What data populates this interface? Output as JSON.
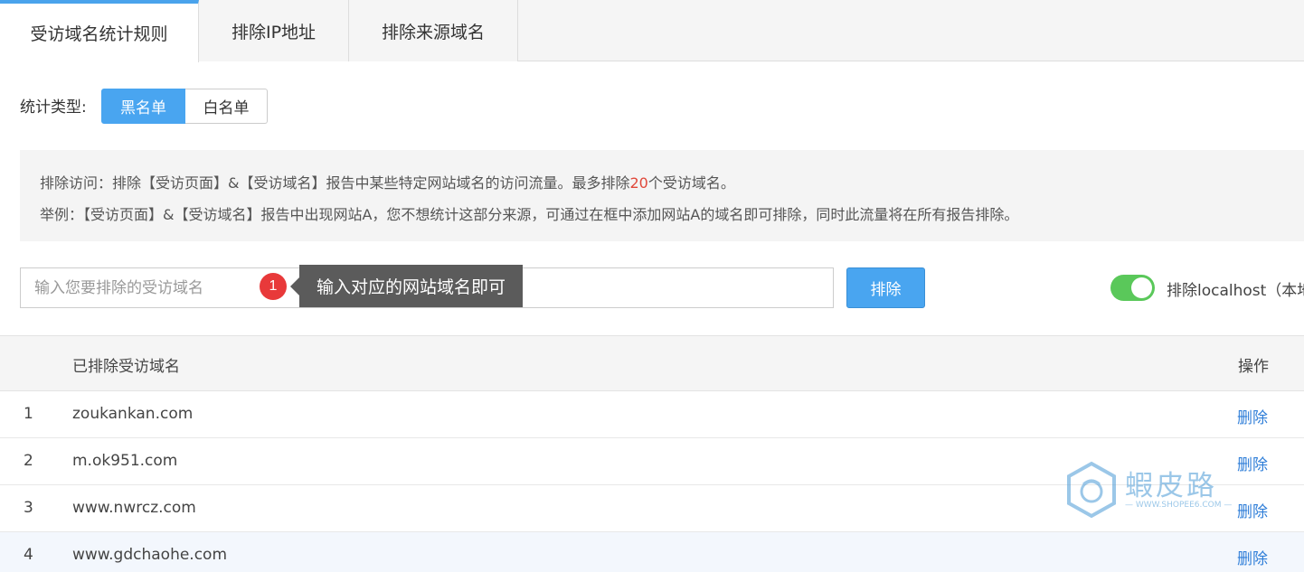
{
  "tabs": [
    {
      "label": "受访域名统计规则",
      "active": true
    },
    {
      "label": "排除IP地址",
      "active": false
    },
    {
      "label": "排除来源域名",
      "active": false
    }
  ],
  "type_selector": {
    "label": "统计类型:",
    "options": [
      "黑名单",
      "白名单"
    ],
    "selected": "黑名单"
  },
  "info": {
    "line1_prefix": "排除访问：排除【受访页面】&【受访域名】报告中某些特定网站域名的访问流量。最多排除",
    "line1_count": "20",
    "line1_suffix": "个受访域名。",
    "line2": "举例：【受访页面】&【受访域名】报告中出现网站A，您不想统计这部分来源，可通过在框中添加网站A的域名即可排除，同时此流量将在所有报告排除。"
  },
  "input": {
    "placeholder": "输入您要排除的受访域名",
    "value": ""
  },
  "annotation": {
    "number": "1",
    "text": "输入对应的网站域名即可"
  },
  "exclude_button": "排除",
  "localhost_toggle": {
    "label": "排除localhost（本地",
    "on": true
  },
  "table": {
    "headers": {
      "index": "",
      "domain": "已排除受访域名",
      "action": "操作"
    },
    "rows": [
      {
        "index": "1",
        "domain": "zoukankan.com",
        "action": "删除"
      },
      {
        "index": "2",
        "domain": "m.ok951.com",
        "action": "删除"
      },
      {
        "index": "3",
        "domain": "www.nwrcz.com",
        "action": "删除"
      },
      {
        "index": "4",
        "domain": "www.gdchaohe.com",
        "action": "删除"
      }
    ]
  },
  "watermark": {
    "title": "蝦皮路",
    "subtitle": "— WWW.SHOPEE6.COM —"
  },
  "colors": {
    "accent": "#49a5f0",
    "toggle_on": "#5ac85a",
    "highlight_number": "#e0483a",
    "link": "#2f7ed8"
  }
}
